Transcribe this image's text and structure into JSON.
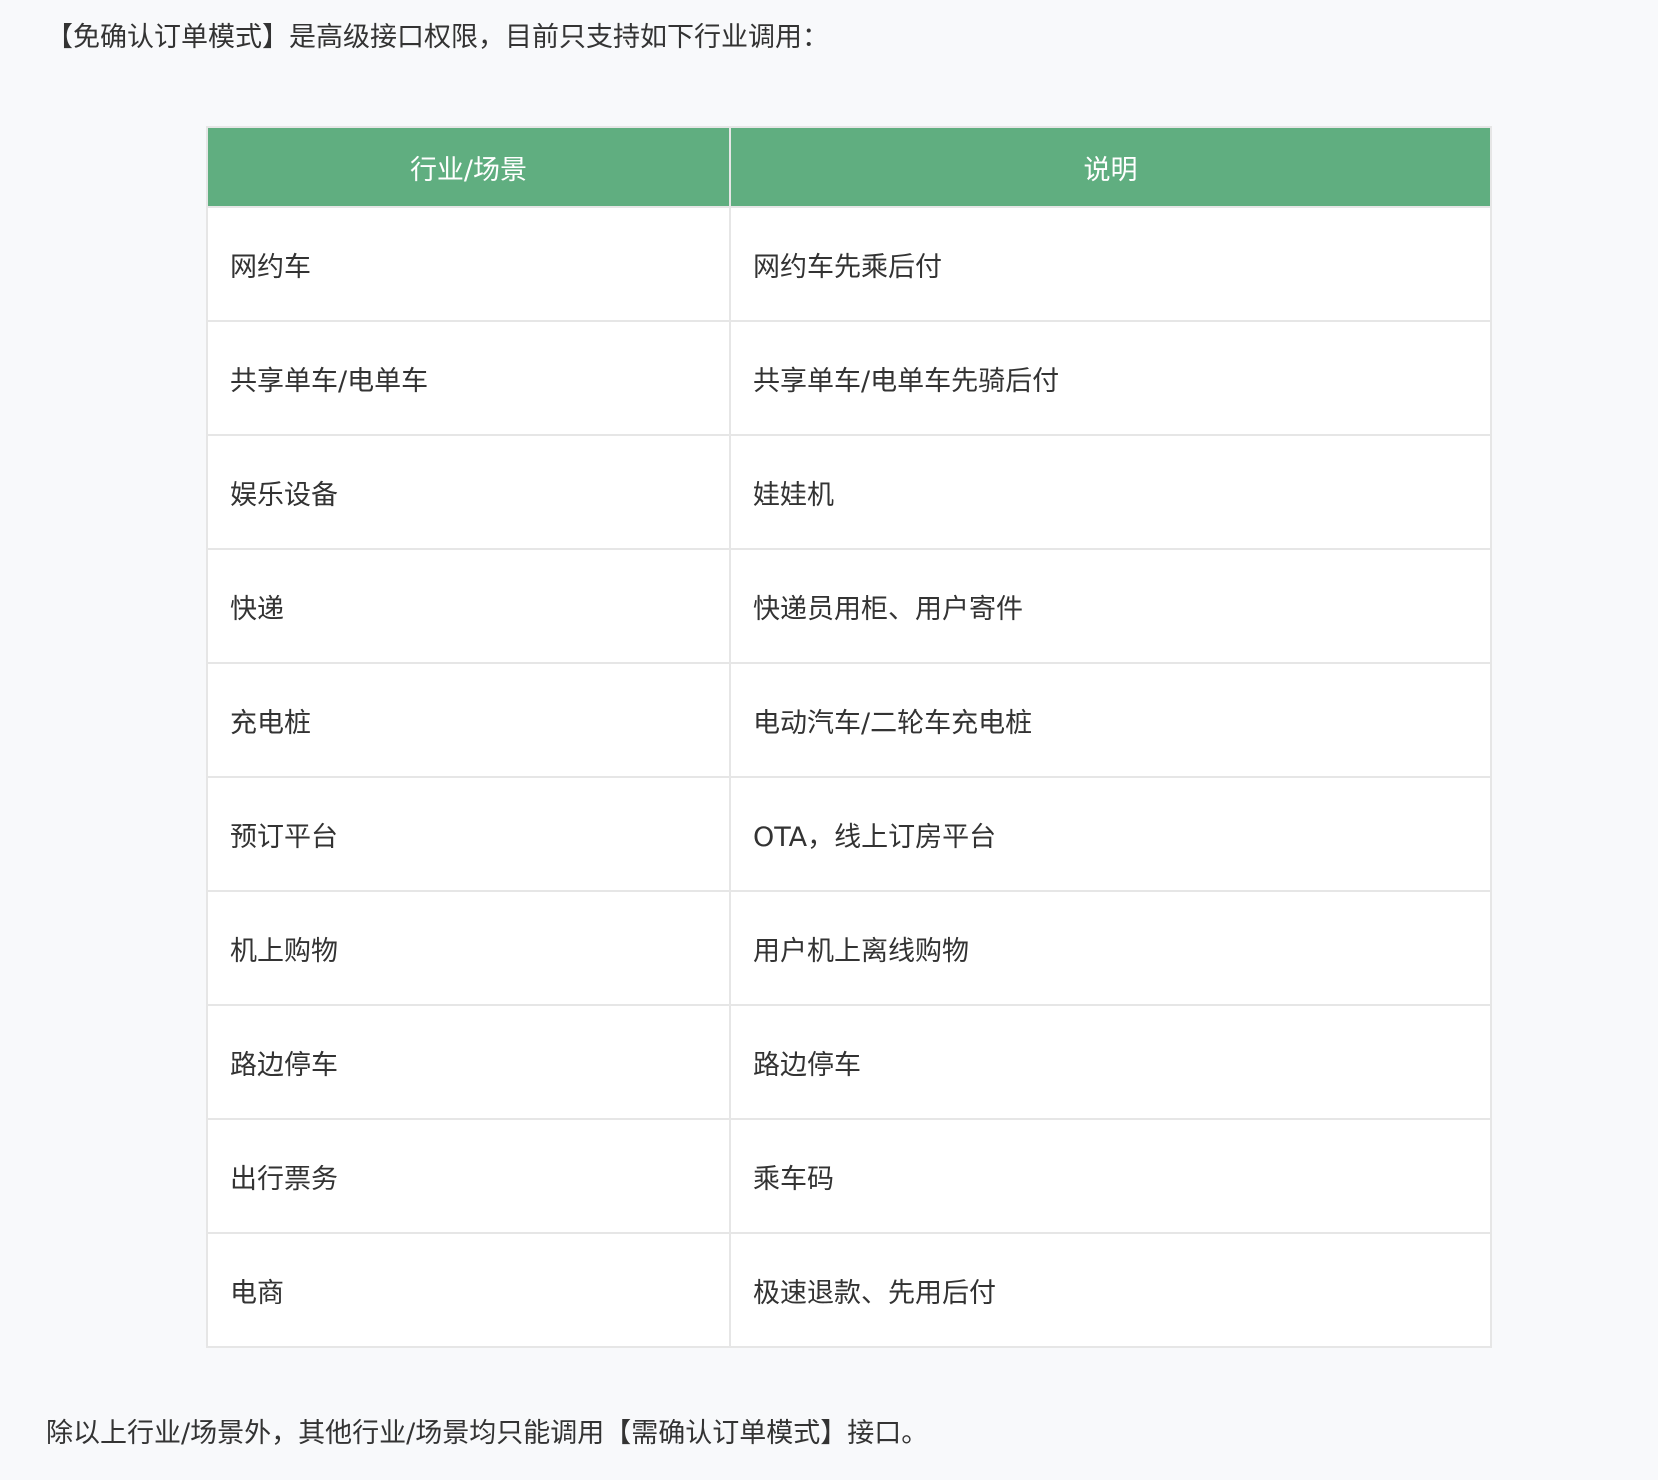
{
  "intro_text": "【免确认订单模式】是高级接口权限，目前只支持如下行业调用：",
  "table": {
    "headers": [
      "行业/场景",
      "说明"
    ],
    "rows": [
      {
        "industry": "网约车",
        "description": "网约车先乘后付"
      },
      {
        "industry": "共享单车/电单车",
        "description": "共享单车/电单车先骑后付"
      },
      {
        "industry": "娱乐设备",
        "description": "娃娃机"
      },
      {
        "industry": "快递",
        "description": "快递员用柜、用户寄件"
      },
      {
        "industry": "充电桩",
        "description": "电动汽车/二轮车充电桩"
      },
      {
        "industry": "预订平台",
        "description": "OTA，线上订房平台"
      },
      {
        "industry": "机上购物",
        "description": "用户机上离线购物"
      },
      {
        "industry": "路边停车",
        "description": "路边停车"
      },
      {
        "industry": "出行票务",
        "description": "乘车码"
      },
      {
        "industry": "电商",
        "description": "极速退款、先用后付"
      }
    ]
  },
  "outro_text": "除以上行业/场景外，其他行业/场景均只能调用【需确认订单模式】接口。",
  "colors": {
    "header_background": "#60ae80",
    "header_text": "#ffffff",
    "body_text": "#333333",
    "border": "#e6e6e6",
    "page_background": "#f8f9fb"
  }
}
